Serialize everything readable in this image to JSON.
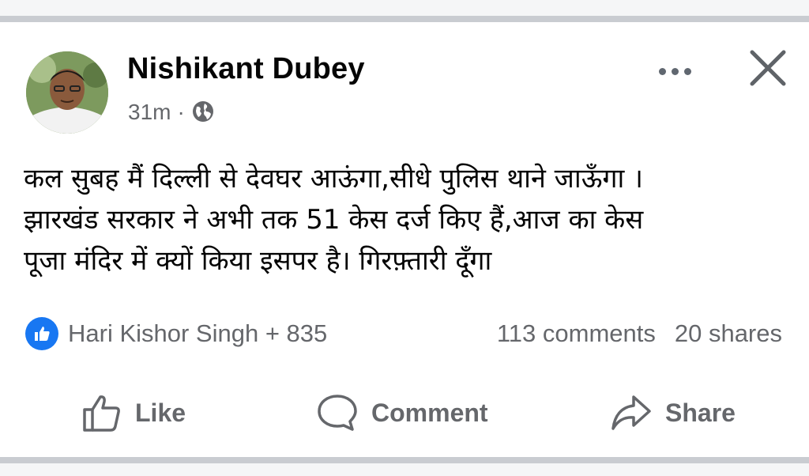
{
  "post": {
    "author": "Nishikant Dubey",
    "time": "31m",
    "separator": "·",
    "audience_icon": "globe-icon",
    "body_lines": [
      "कल सुबह मैं दिल्ली से देवघर आऊंगा,सीधे पुलिस थाने जाऊँगा ।",
      "झारखंड सरकार ने अभी तक 51 केस दर्ज किए हैं,आज का केस",
      "पूजा मंदिर में क्यों किया इसपर है। गिरफ़्तारी दूँगा"
    ],
    "reactions_text": "Hari Kishor Singh + 835",
    "comments_text": "113 comments",
    "shares_text": "20 shares",
    "actions": {
      "like": "Like",
      "comment": "Comment",
      "share": "Share"
    }
  },
  "colors": {
    "accent": "#1877f2",
    "secondary_text": "#65676b",
    "primary_text": "#050505"
  }
}
